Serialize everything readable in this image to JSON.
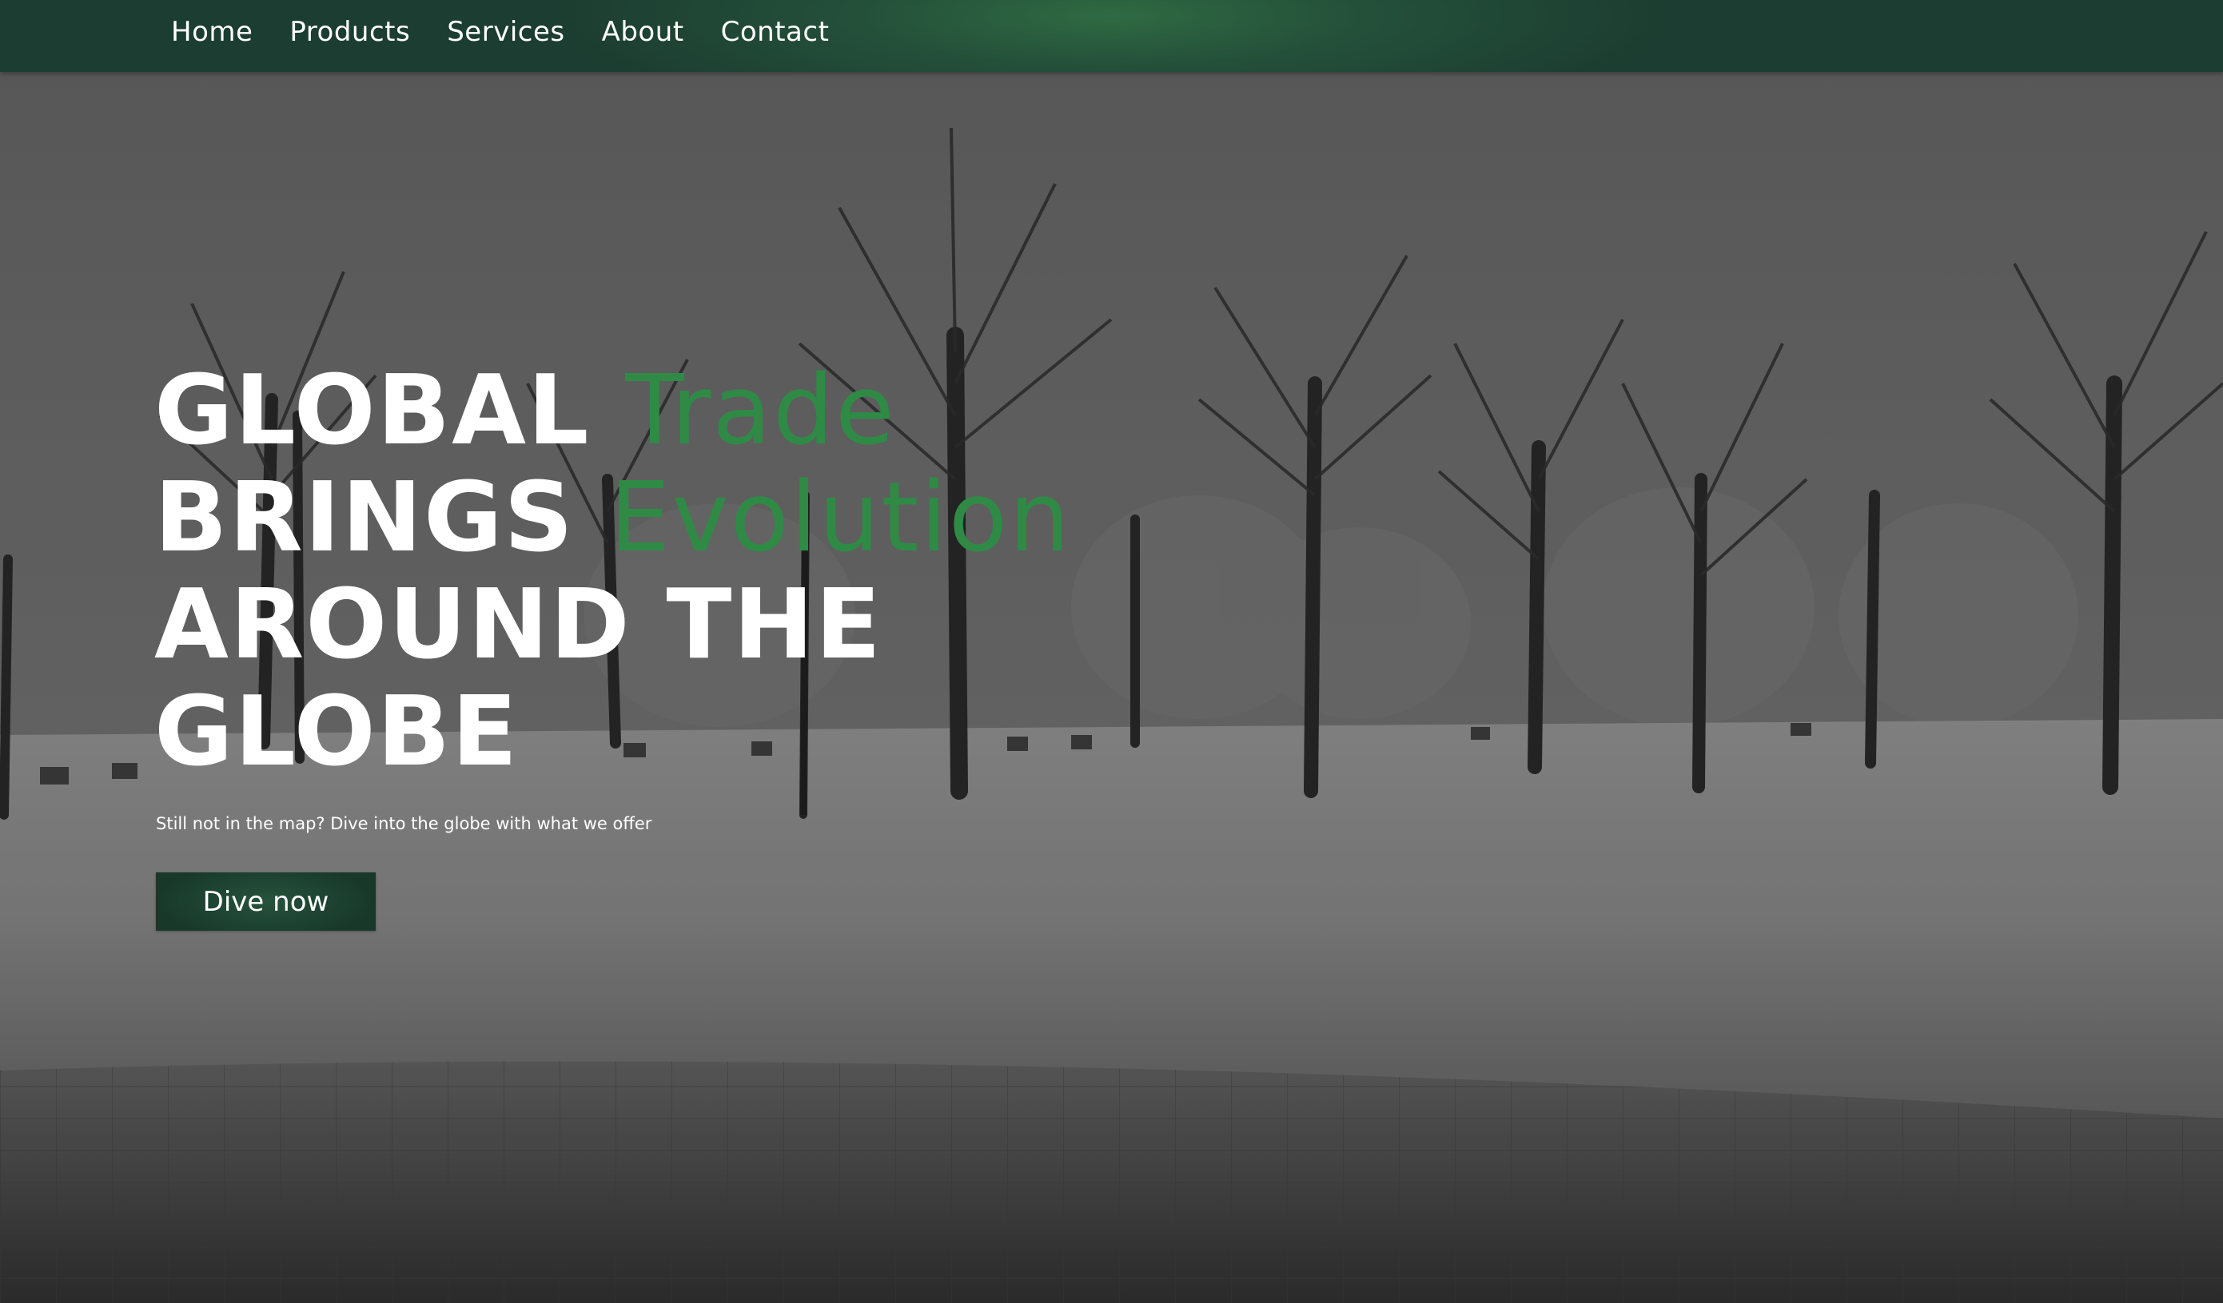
{
  "nav": {
    "items": [
      {
        "label": "Home"
      },
      {
        "label": "Products"
      },
      {
        "label": "Services"
      },
      {
        "label": "About"
      },
      {
        "label": "Contact"
      }
    ]
  },
  "hero": {
    "line1_main": "GLOBAL ",
    "line1_accent": "Trade",
    "line2_main": "BRINGS ",
    "line2_accent": "Evolution",
    "line3": "AROUND THE",
    "line4": "GLOBE",
    "subtitle": "Still not in the map? Dive into the globe with what we offer",
    "cta_label": "Dive now"
  },
  "colors": {
    "nav_bg": "#1c3d31",
    "accent_green": "#2f8a46",
    "button_bg": "#1d4232",
    "text": "#ffffff"
  },
  "background": {
    "scene": "snowy-park-with-bare-trees"
  }
}
